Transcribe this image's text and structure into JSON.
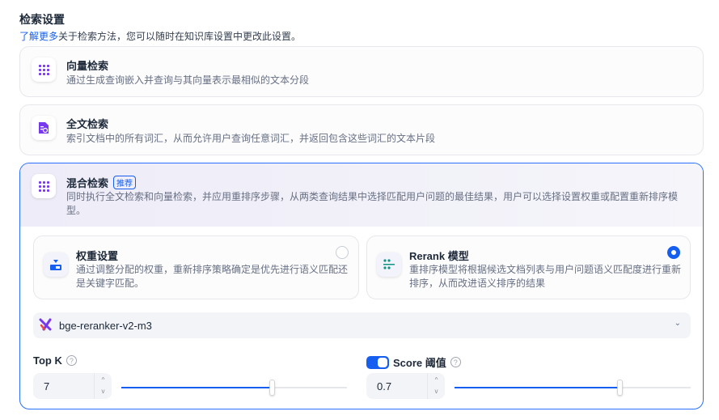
{
  "header": {
    "title": "检索设置",
    "learn_more": "了解更多",
    "subtitle": "关于检索方法，您可以随时在知识库设置中更改此设置。"
  },
  "methods": [
    {
      "title": "向量检索",
      "desc": "通过生成查询嵌入并查询与其向量表示最相似的文本分段"
    },
    {
      "title": "全文检索",
      "desc": "索引文档中的所有词汇，从而允许用户查询任意词汇，并返回包含这些词汇的文本片段"
    },
    {
      "title": "混合检索",
      "badge": "推荐",
      "desc": "同时执行全文检索和向量检索，并应用重排序步骤，从两类查询结果中选择匹配用户问题的最佳结果，用户可以选择设置权重或配置重新排序模型。"
    }
  ],
  "rerank_options": [
    {
      "title": "权重设置",
      "desc": "通过调整分配的权重，重新排序策略确定是优先进行语义匹配还是关键字匹配。",
      "selected": false
    },
    {
      "title": "Rerank 模型",
      "desc": "重排序模型将根据候选文档列表与用户问题语义匹配度进行重新排序，从而改进语义排序的结果",
      "selected": true
    }
  ],
  "model": {
    "selected": "bge-reranker-v2-m3"
  },
  "top_k": {
    "label": "Top K",
    "value": "7",
    "fraction": 0.667
  },
  "score": {
    "label": "Score 阈值",
    "value": "0.7",
    "enabled": true,
    "fraction": 0.7
  },
  "colors": {
    "accent": "#155eef",
    "icon": "#7839ee"
  }
}
